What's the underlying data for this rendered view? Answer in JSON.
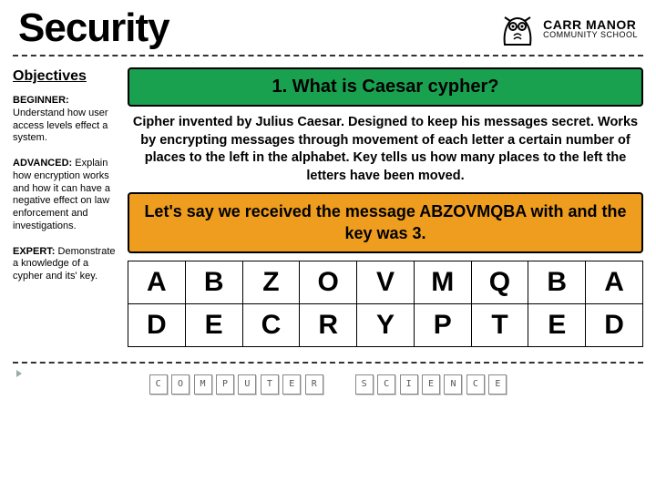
{
  "header": {
    "title": "Security",
    "school_top": "CARR MANOR",
    "school_bot": "COMMUNITY SCHOOL"
  },
  "sidebar": {
    "title": "Objectives",
    "beginner_label": "BEGINNER:",
    "beginner_text": "Understand how user access levels effect a system.",
    "advanced_label": "ADVANCED:",
    "advanced_text": "Explain how encryption works and how it can have a negative effect on law enforcement and investigations.",
    "expert_label": "EXPERT:",
    "expert_text": "Demonstrate a knowledge of a cypher and its' key."
  },
  "main": {
    "question": "1. What is Caesar cypher?",
    "description": "Cipher invented by Julius Caesar. Designed to keep his messages secret. Works by encrypting messages through movement of each letter a certain number of places to the left in the alphabet. Key tells us how many places to the left the letters have been moved.",
    "example": "Let's say we received the message ABZOVMQBA with and the key was 3.",
    "row1": [
      "A",
      "B",
      "Z",
      "O",
      "V",
      "M",
      "Q",
      "B",
      "A"
    ],
    "row2": [
      "D",
      "E",
      "C",
      "R",
      "Y",
      "P",
      "T",
      "E",
      "D"
    ]
  },
  "footer": {
    "word1": [
      "C",
      "O",
      "M",
      "P",
      "U",
      "T",
      "E",
      "R"
    ],
    "word2": [
      "S",
      "C",
      "I",
      "E",
      "N",
      "C",
      "E"
    ]
  }
}
